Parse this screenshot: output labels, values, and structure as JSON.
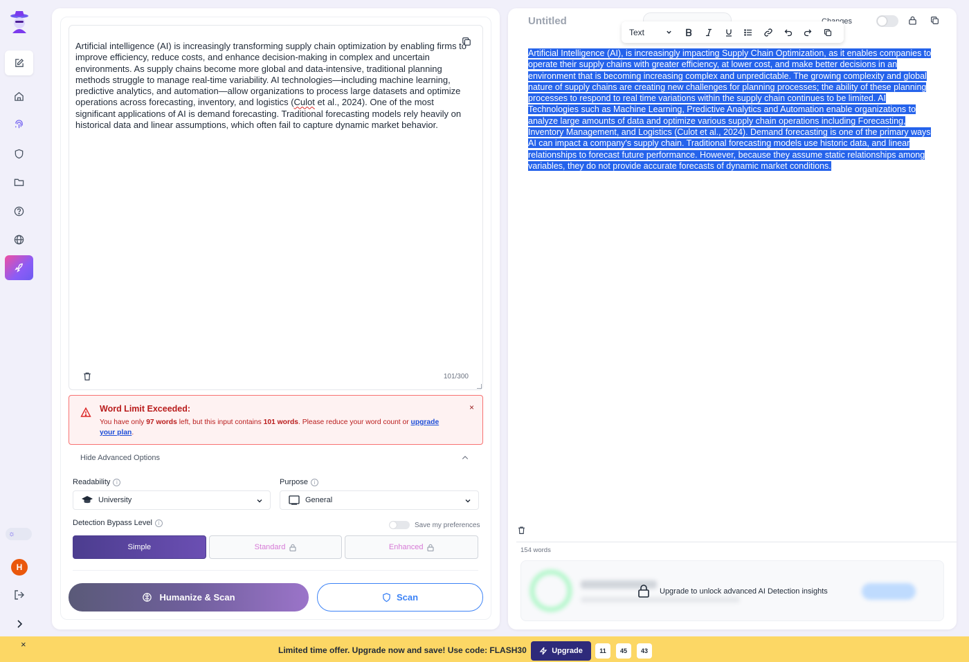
{
  "sidebar": {
    "avatar_initial": "H",
    "icons": [
      "edit-icon",
      "home-icon",
      "fingerprint-icon",
      "shield-icon",
      "folder-icon",
      "help-icon",
      "globe-icon",
      "rocket-icon"
    ]
  },
  "input_panel": {
    "text_part1": "Artificial intelligence (AI) is increasingly transforming supply chain optimization by enabling firms to improve efficiency, reduce costs, and enhance decision-making in complex and uncertain environments. As supply chains become more global and data-intensive, traditional planning methods struggle to manage real-time variability. AI technologies—including machine learning, predictive analytics, and automation—allow organizations to process large datasets and optimize operations across forecasting, inventory, and logistics (",
    "text_misspelled": "Culot",
    "text_part2": " et al., 2024). One of the most significant applications of AI is demand forecasting. Traditional forecasting models rely heavily on historical data and linear assumptions, which often fail to capture dynamic market behavior.",
    "word_counter": "101/300"
  },
  "alert": {
    "title": "Word Limit Exceeded:",
    "msg_a": "You have only ",
    "words_left": "97 words",
    "msg_b": " left, but this input contains ",
    "words_input": "101 words",
    "msg_c": ". Please reduce your word count or ",
    "link": "upgrade your plan",
    "msg_d": ".",
    "close": "×"
  },
  "advanced": {
    "toggle_label": "Hide Advanced Options",
    "readability_label": "Readability",
    "readability_value": "University",
    "purpose_label": "Purpose",
    "purpose_value": "General",
    "bypass_label": "Detection Bypass Level",
    "save_pref_label": "Save my preferences",
    "levels": [
      "Simple",
      "Standard",
      "Enhanced"
    ]
  },
  "actions": {
    "humanize_label": "Humanize & Scan",
    "scan_label": "Scan"
  },
  "output_panel": {
    "title": "Untitled",
    "changes_label": "Changes",
    "toolbar_text": "Text",
    "text": "Artificial Intelligence (AI), is increasingly impacting Supply Chain Optimization, as it enables companies to operate their supply chains with greater efficiency, at lower cost, and make better decisions in an environment that is becoming increasing complex and unpredictable. The growing complexity and global nature of supply chains are creating new challenges for planning processes; the ability of these planning processes to respond to real time variations within the supply chain continues to be limited. AI Technologies such as Machine Learning, Predictive Analytics and Automation enable organizations to analyze large amounts of data and optimize various supply chain operations including Forecasting, Inventory Management, and Logistics (Culot et al., 2024). Demand forecasting is one of the primary ways AI can impact a company's supply chain. Traditional forecasting models use historic data, and linear relationships to forecast future performance. However, because they assume static relationships among variables, they do not provide accurate forecasts of dynamic market conditions.",
    "word_count": "154 words",
    "upsell_text": "Upgrade to unlock advanced AI Detection insights"
  },
  "promo": {
    "close": "×",
    "text": "Limited time offer. Upgrade now and save! Use code: FLASH30",
    "upgrade_label": "Upgrade",
    "timer": [
      "11",
      "45",
      "43"
    ]
  },
  "colors": {
    "accent": "#6d5bf0",
    "selection": "#2563eb",
    "alert_red": "#b91c1c",
    "promo_bg": "#fcd765"
  }
}
